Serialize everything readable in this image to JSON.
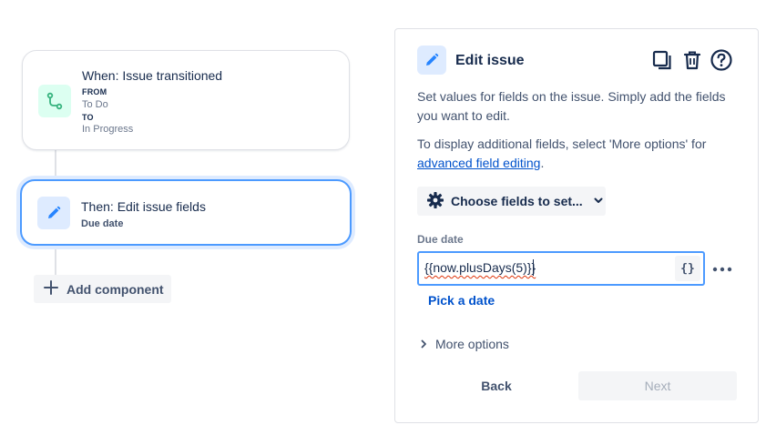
{
  "flow": {
    "trigger": {
      "title": "When: Issue transitioned",
      "from_label": "FROM",
      "from_value": "To Do",
      "to_label": "TO",
      "to_value": "In Progress",
      "icon": "transition-icon"
    },
    "action": {
      "title": "Then: Edit issue fields",
      "subtitle": "Due date",
      "icon": "pencil-icon"
    },
    "add_component_label": "Add component"
  },
  "panel": {
    "title": "Edit issue",
    "actions": [
      "duplicate-icon",
      "delete-icon",
      "help-icon"
    ],
    "description": "Set values for fields on the issue. Simply add the fields you want to edit.",
    "advanced_text": "To display additional fields, select 'More options' for",
    "advanced_link": "advanced field editing",
    "advanced_suffix": ".",
    "choose_fields_label": "Choose fields to set...",
    "field": {
      "label": "Due date",
      "value": "{{now.plusDays(5)}}",
      "smart_value_button": "{}"
    },
    "pick_date_label": "Pick a date",
    "more_options_label": "More options",
    "back_label": "Back",
    "next_label": "Next"
  },
  "colors": {
    "accent_blue": "#0052cc",
    "selected_border": "#4c9aff",
    "trigger_icon_bg": "#dcfff1",
    "trigger_icon": "#36b37e",
    "action_icon_bg": "#deebff",
    "action_icon": "#2684ff",
    "spellcheck_underline": "#de350b"
  }
}
